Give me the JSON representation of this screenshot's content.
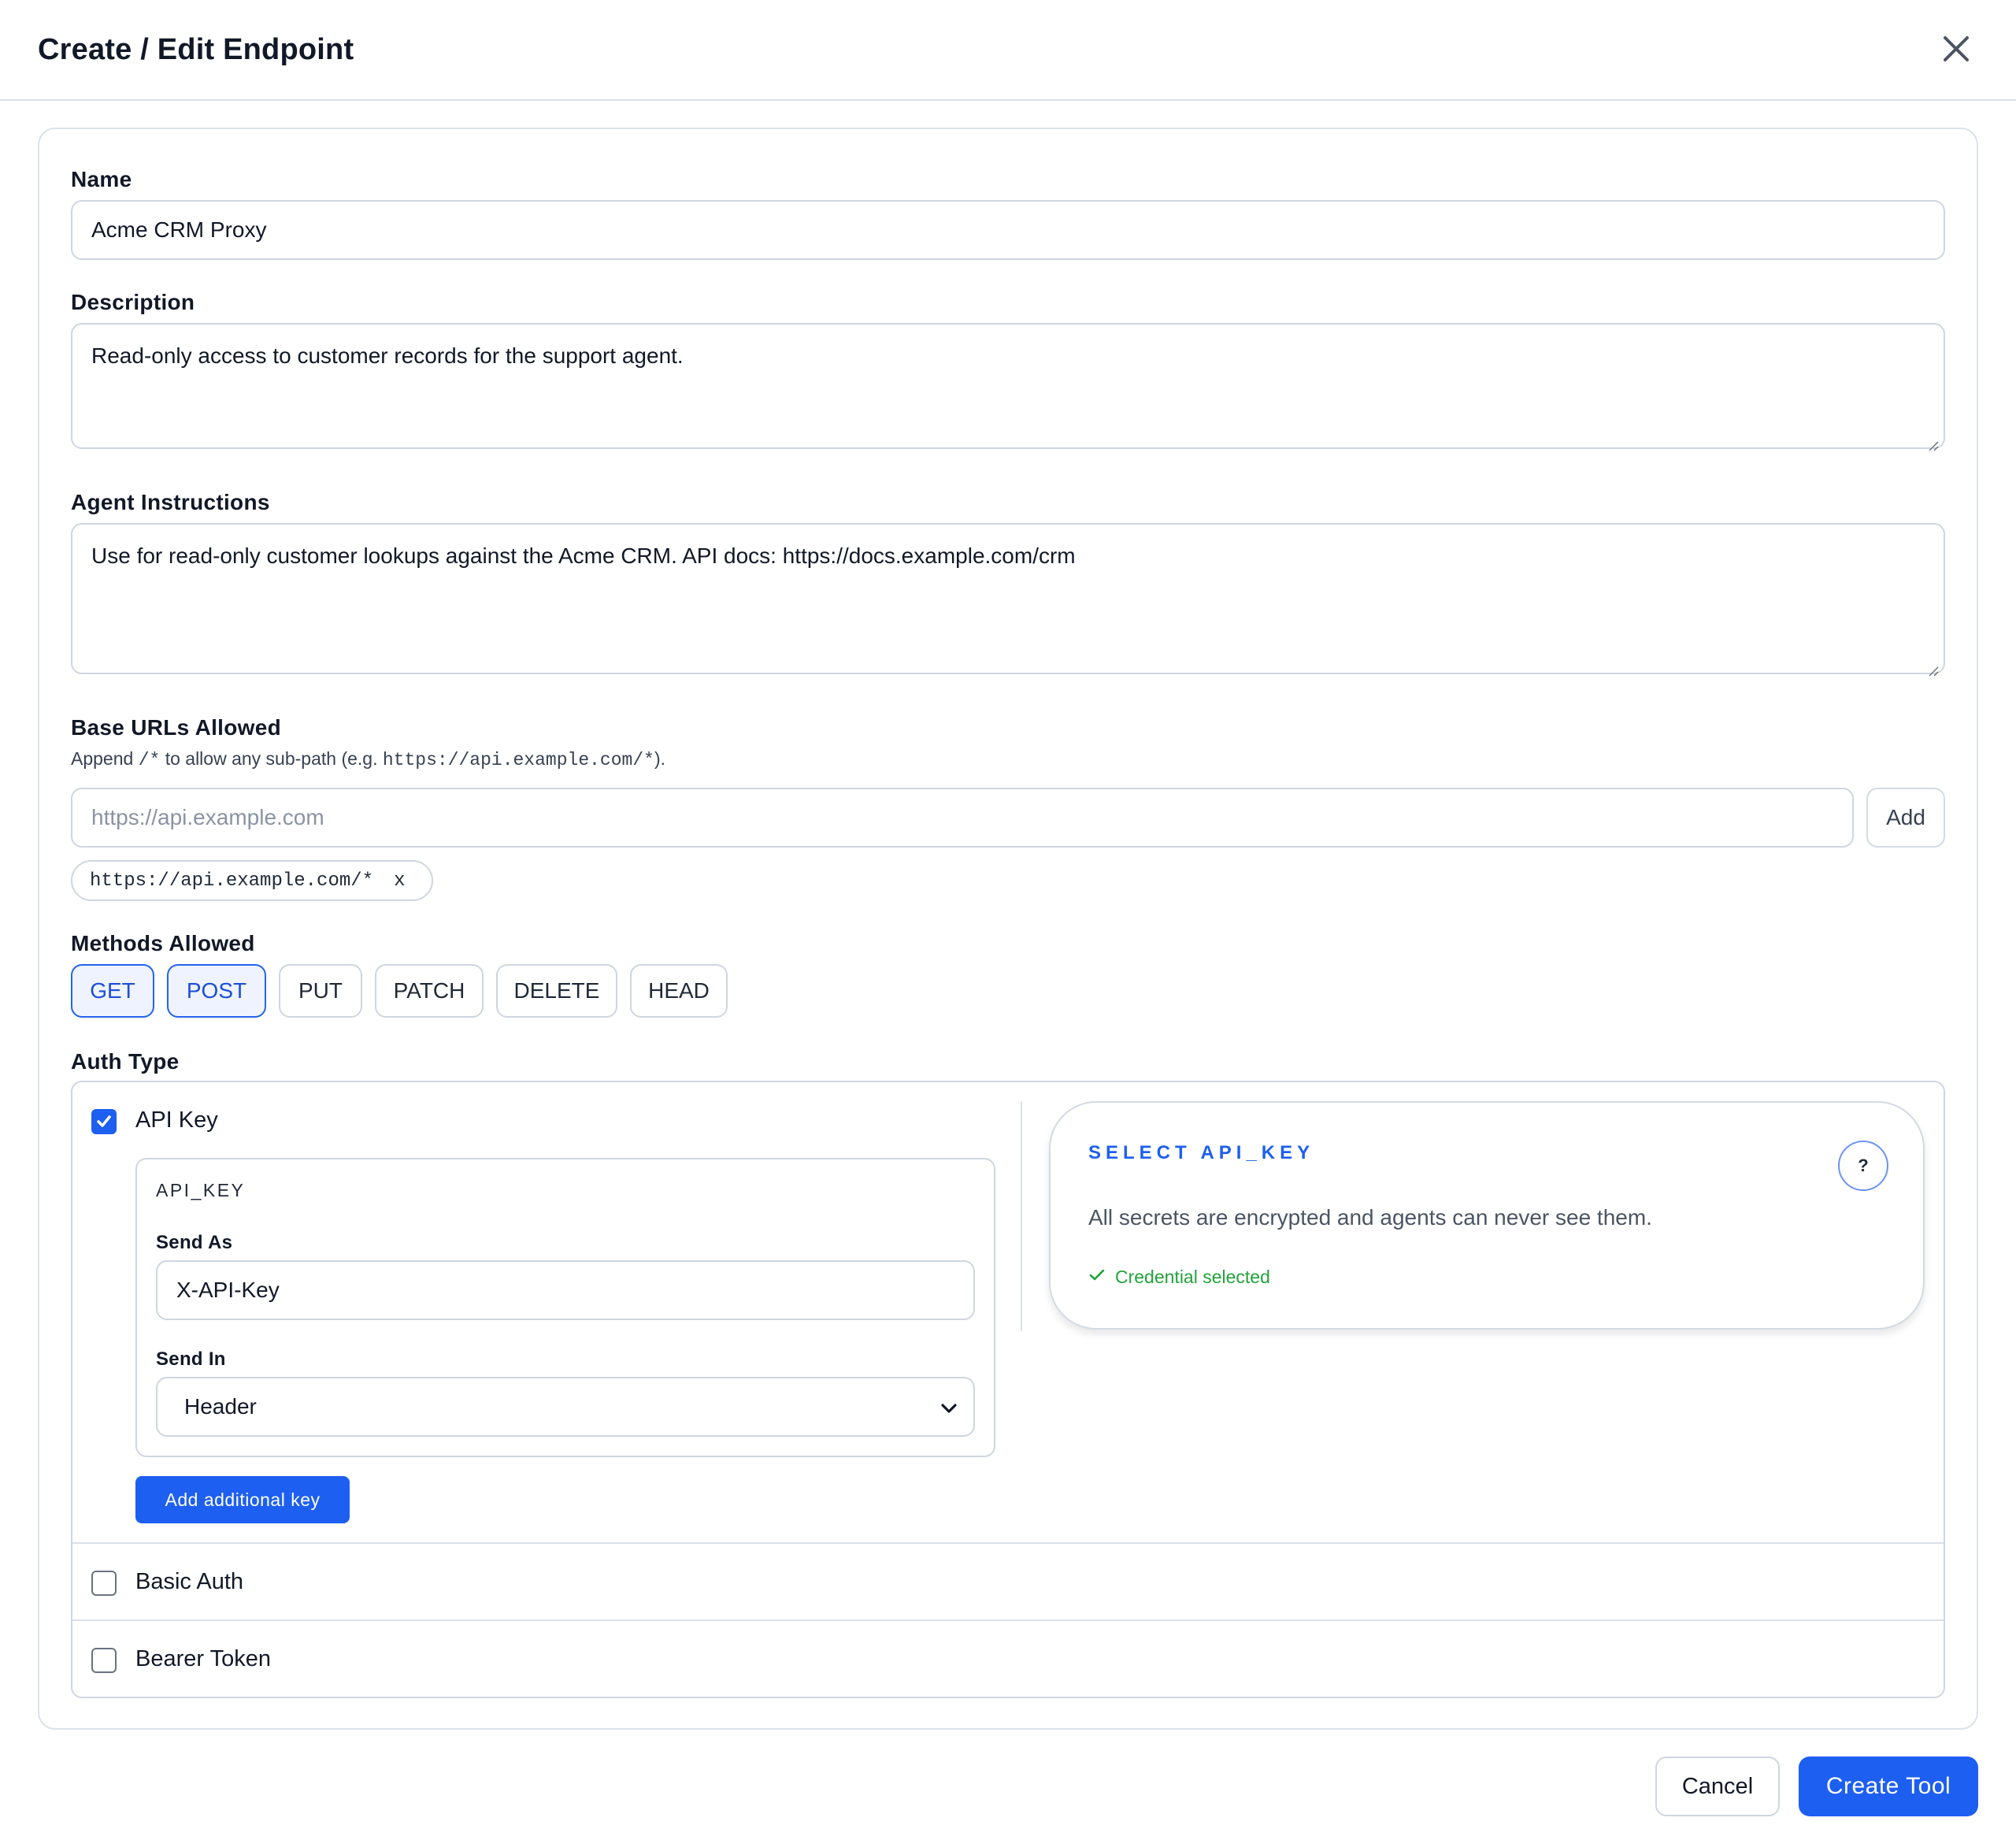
{
  "header": {
    "title": "Create / Edit Endpoint",
    "close_icon": "close-icon"
  },
  "form": {
    "name": {
      "label": "Name",
      "value": "Acme CRM Proxy"
    },
    "description": {
      "label": "Description",
      "value": "Read-only access to customer records for the support agent."
    },
    "agent_instructions": {
      "label": "Agent Instructions",
      "value": "Use for read-only customer lookups against the Acme CRM. API docs: https://docs.example.com/crm"
    },
    "base_urls": {
      "label": "Base URLs Allowed",
      "hint_prefix": "Append ",
      "hint_code1": "/*",
      "hint_middle": " to allow any sub-path (e.g. ",
      "hint_code2": "https://api.example.com/*",
      "hint_suffix": ").",
      "input_placeholder": "https://api.example.com",
      "add_label": "Add",
      "tags": [
        {
          "value": "https://api.example.com/*",
          "remove_label": "x"
        }
      ]
    },
    "methods": {
      "label": "Methods Allowed",
      "items": [
        {
          "label": "GET",
          "selected": true
        },
        {
          "label": "POST",
          "selected": true
        },
        {
          "label": "PUT",
          "selected": false
        },
        {
          "label": "PATCH",
          "selected": false
        },
        {
          "label": "DELETE",
          "selected": false
        },
        {
          "label": "HEAD",
          "selected": false
        }
      ]
    },
    "auth": {
      "label": "Auth Type",
      "options": [
        {
          "label": "API Key",
          "checked": true
        },
        {
          "label": "Basic Auth",
          "checked": false
        },
        {
          "label": "Bearer Token",
          "checked": false
        }
      ],
      "api_key": {
        "key_title": "API_KEY",
        "send_as_label": "Send As",
        "send_as_value": "X-API-Key",
        "send_in_label": "Send In",
        "send_in_value": "Header",
        "add_key_label": "Add additional key"
      },
      "secret": {
        "title": "SELECT API_KEY",
        "help_label": "?",
        "description": "All secrets are encrypted and agents can never see them.",
        "status": "Credential selected",
        "status_color": "#22a23a"
      }
    }
  },
  "footer": {
    "cancel_label": "Cancel",
    "submit_label": "Create Tool"
  },
  "colors": {
    "primary": "#1d5ff0",
    "border": "#cfd6e1",
    "selected_bg": "#eef3ff"
  }
}
